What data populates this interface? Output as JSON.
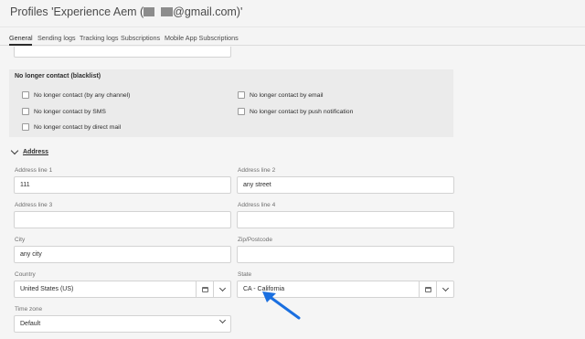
{
  "window": {
    "title_prefix": "Profiles 'Experience Aem (",
    "title_suffix": "@gmail.com)'"
  },
  "tabs": [
    {
      "label": "General",
      "active": true
    },
    {
      "label": "Sending logs",
      "active": false
    },
    {
      "label": "Tracking logs",
      "active": false
    },
    {
      "label": "Subscriptions",
      "active": false
    },
    {
      "label": "Mobile App Subscriptions",
      "active": false
    }
  ],
  "blacklist": {
    "title": "No longer contact (blacklist)",
    "options": [
      {
        "label": "No longer contact (by any channel)",
        "checked": false
      },
      {
        "label": "No longer contact by email",
        "checked": false
      },
      {
        "label": "No longer contact by SMS",
        "checked": false
      },
      {
        "label": "No longer contact by push notification",
        "checked": false
      },
      {
        "label": "No longer contact by direct mail",
        "checked": false
      }
    ]
  },
  "address": {
    "title": "Address",
    "address_line1": {
      "label": "Address line 1",
      "value": "111"
    },
    "address_line2": {
      "label": "Address line 2",
      "value": "any street"
    },
    "address_line3": {
      "label": "Address line 3",
      "value": ""
    },
    "address_line4": {
      "label": "Address line 4",
      "value": ""
    },
    "city": {
      "label": "City",
      "value": "any city"
    },
    "zip": {
      "label": "Zip/Postcode",
      "value": ""
    },
    "country": {
      "label": "Country",
      "value": "United States (US)"
    },
    "state": {
      "label": "State",
      "value": "CA - California"
    },
    "timezone": {
      "label": "Time zone",
      "value": "Default"
    }
  },
  "colors": {
    "annotation_arrow": "#1a6fe0"
  },
  "icons": {
    "section_toggle": "chevron-down-icon",
    "combo_browse": "folder-icon",
    "combo_dropdown": "chevron-down-icon",
    "annotation": "arrow-icon"
  }
}
